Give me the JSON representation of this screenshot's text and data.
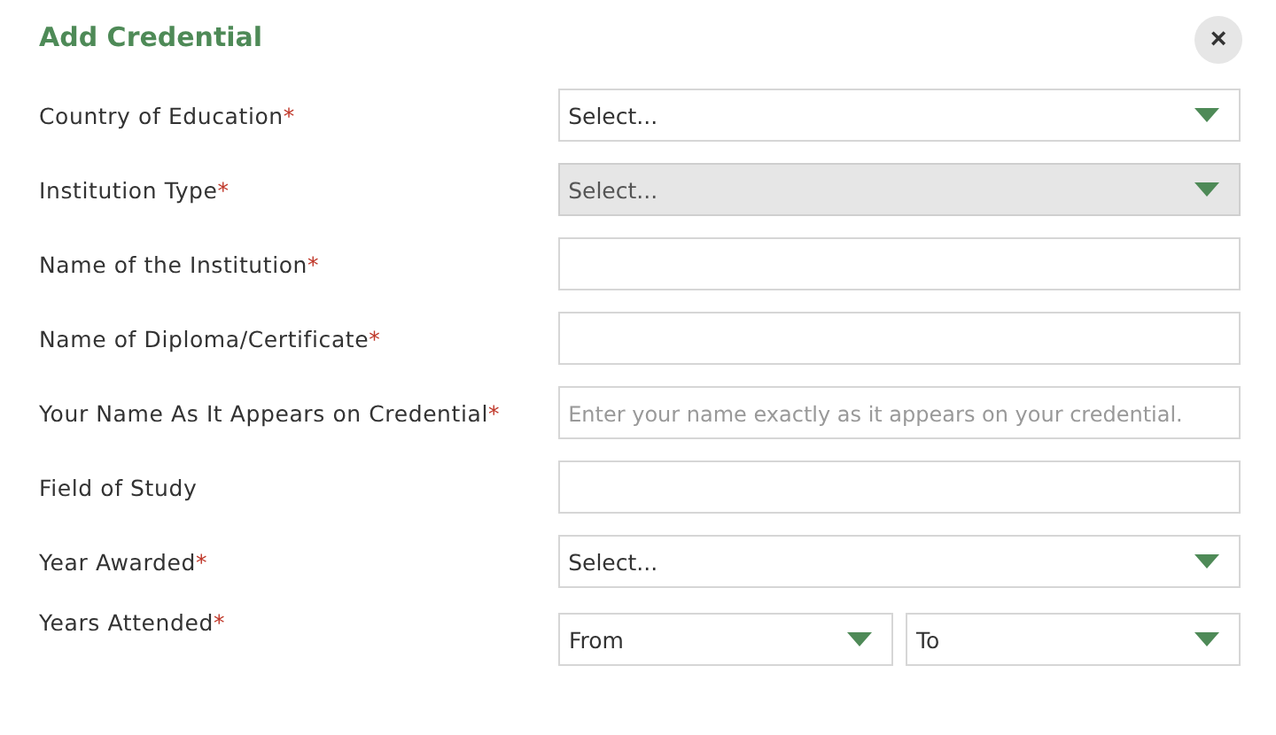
{
  "dialog": {
    "title": "Add Credential",
    "close": "×"
  },
  "fields": [
    {
      "kind": "select",
      "label": "Country of Education",
      "required_mark": "*",
      "value": "Select...",
      "disabled": false
    },
    {
      "kind": "select",
      "label": "Institution Type",
      "required_mark": "*",
      "value": "Select...",
      "disabled": true
    },
    {
      "kind": "text",
      "label": "Name of the Institution",
      "required_mark": "*"
    },
    {
      "kind": "text",
      "label": "Name of Diploma/Certificate",
      "required_mark": "*"
    },
    {
      "kind": "text",
      "label": "Your Name As It Appears on Credential",
      "required_mark": "*",
      "placeholder": "Enter your name exactly as it appears on your credential."
    },
    {
      "kind": "text",
      "label": "Field of Study"
    },
    {
      "kind": "select",
      "label": "Year Awarded",
      "required_mark": "*",
      "value": "Select...",
      "disabled": false
    },
    {
      "kind": "range",
      "label": "Years Attended",
      "required_mark": "*",
      "from": "From",
      "to": "To"
    }
  ]
}
